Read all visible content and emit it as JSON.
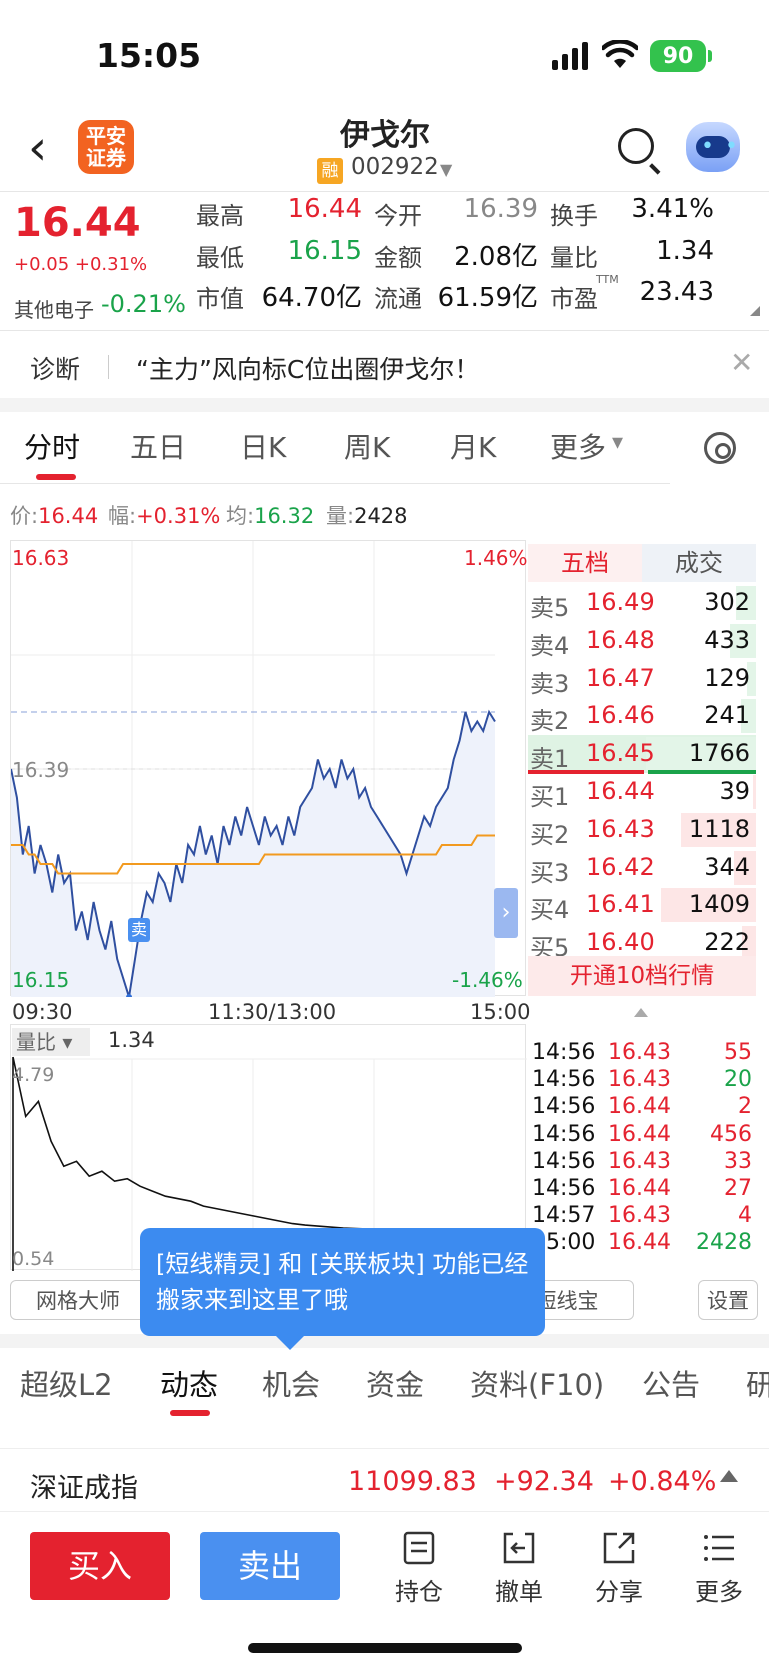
{
  "status": {
    "time": "15:05",
    "battery": "90"
  },
  "header": {
    "title": "伊戈尔",
    "logo": "平安\n证券",
    "rong": "融",
    "code": "002922"
  },
  "quote": {
    "price": "16.44",
    "change": "+0.05 +0.31%",
    "sector": "其他电子",
    "sector_change": "-0.21%",
    "rows": [
      [
        {
          "l": "最高",
          "v": "16.44",
          "c": "red"
        },
        {
          "l": "今开",
          "v": "16.39",
          "c": "gray"
        },
        {
          "l": "换手",
          "v": "3.41%",
          "c": "dark"
        }
      ],
      [
        {
          "l": "最低",
          "v": "16.15",
          "c": "green"
        },
        {
          "l": "金额",
          "v": "2.08亿",
          "c": "dark"
        },
        {
          "l": "量比",
          "v": "1.34",
          "c": "dark"
        }
      ],
      [
        {
          "l": "市值",
          "v": "64.70亿",
          "c": "dark"
        },
        {
          "l": "流通",
          "v": "61.59亿",
          "c": "dark"
        },
        {
          "l": "市盈",
          "v": "23.43",
          "c": "dark",
          "sup": "TTM"
        }
      ]
    ]
  },
  "diag": {
    "label": "诊断",
    "text": "“主力”风向标C位出圈伊戈尔！"
  },
  "chart_tabs": [
    "分时",
    "五日",
    "日K",
    "周K",
    "月K",
    "更多"
  ],
  "info": {
    "price_l": "价:",
    "price": "16.44",
    "amp_l": "幅:",
    "amp": "+0.31%",
    "avg_l": "均:",
    "avg": "16.32",
    "vol_l": "量:",
    "vol": "2428"
  },
  "chart_data": {
    "type": "line",
    "y_ticks": {
      "top": "16.63",
      "mid": "16.39",
      "bottom": "16.15",
      "top_pct": "1.46%",
      "bottom_pct": "-1.46%"
    },
    "x_ticks": [
      "09:30",
      "11:30/13:00",
      "15:00"
    ],
    "ylim": [
      16.15,
      16.63
    ],
    "prev_close": 16.39,
    "series": [
      {
        "values": [
          16.39,
          16.36,
          16.3,
          16.33,
          16.28,
          16.31,
          16.29,
          16.26,
          16.3,
          16.27,
          16.28,
          16.22,
          16.24,
          16.21,
          16.25,
          16.22,
          16.2,
          16.23,
          16.19,
          16.17,
          16.15,
          16.19,
          16.23,
          16.26,
          16.25,
          16.28,
          16.27,
          16.25,
          16.29,
          16.27,
          16.31,
          16.3,
          16.33,
          16.3,
          16.32,
          16.29,
          16.33,
          16.31,
          16.34,
          16.32,
          16.35,
          16.33,
          16.31,
          16.34,
          16.32,
          16.33,
          16.31,
          16.34,
          16.32,
          16.35,
          16.36,
          16.37,
          16.4,
          16.38,
          16.39,
          16.37,
          16.4,
          16.38,
          16.39,
          16.36,
          16.37,
          16.35,
          16.34,
          16.33,
          16.32,
          16.31,
          16.3,
          16.28,
          16.3,
          16.32,
          16.34,
          16.33,
          16.35,
          16.36,
          16.37,
          16.4,
          16.42,
          16.45,
          16.43,
          16.44,
          16.43,
          16.45,
          16.44
        ]
      },
      {
        "values": [
          16.31,
          16.31,
          16.31,
          16.3,
          16.3,
          16.29,
          16.29,
          16.29,
          16.28,
          16.28,
          16.28,
          16.28,
          16.28,
          16.28,
          16.28,
          16.28,
          16.28,
          16.28,
          16.28,
          16.29,
          16.29,
          16.29,
          16.29,
          16.29,
          16.29,
          16.29,
          16.29,
          16.29,
          16.29,
          16.29,
          16.29,
          16.29,
          16.29,
          16.29,
          16.29,
          16.29,
          16.29,
          16.29,
          16.29,
          16.29,
          16.29,
          16.29,
          16.29,
          16.3,
          16.3,
          16.3,
          16.3,
          16.3,
          16.3,
          16.3,
          16.3,
          16.3,
          16.3,
          16.3,
          16.3,
          16.3,
          16.3,
          16.3,
          16.3,
          16.3,
          16.3,
          16.3,
          16.3,
          16.3,
          16.3,
          16.3,
          16.3,
          16.3,
          16.3,
          16.3,
          16.3,
          16.3,
          16.3,
          16.31,
          16.31,
          16.31,
          16.31,
          16.31,
          16.31,
          16.32,
          16.32,
          16.32,
          16.32
        ]
      }
    ],
    "sell_marker": "卖"
  },
  "orderbook": {
    "tabs": [
      "五档",
      "成交"
    ],
    "asks": [
      {
        "l": "卖5",
        "p": "16.49",
        "v": "302",
        "w": 0.18
      },
      {
        "l": "卖4",
        "p": "16.48",
        "v": "433",
        "w": 0.24
      },
      {
        "l": "卖3",
        "p": "16.47",
        "v": "129",
        "w": 0.08
      },
      {
        "l": "卖2",
        "p": "16.46",
        "v": "241",
        "w": 0.14
      },
      {
        "l": "卖1",
        "p": "16.45",
        "v": "1766",
        "w": 1.0
      }
    ],
    "bids": [
      {
        "l": "买1",
        "p": "16.44",
        "v": "39",
        "w": 0.03
      },
      {
        "l": "买2",
        "p": "16.43",
        "v": "1118",
        "w": 0.68
      },
      {
        "l": "买3",
        "p": "16.42",
        "v": "344",
        "w": 0.2
      },
      {
        "l": "买4",
        "p": "16.41",
        "v": "1409",
        "w": 0.86
      },
      {
        "l": "买5",
        "p": "16.40",
        "v": "222",
        "w": 0.13
      }
    ],
    "open10": "开通10档行情"
  },
  "ticks": [
    {
      "t": "14:56",
      "p": "16.43",
      "v": "55",
      "c": "red"
    },
    {
      "t": "14:56",
      "p": "16.43",
      "v": "20",
      "c": "green"
    },
    {
      "t": "14:56",
      "p": "16.44",
      "v": "2",
      "c": "red"
    },
    {
      "t": "14:56",
      "p": "16.44",
      "v": "456",
      "c": "red"
    },
    {
      "t": "14:56",
      "p": "16.43",
      "v": "33",
      "c": "red"
    },
    {
      "t": "14:56",
      "p": "16.44",
      "v": "27",
      "c": "red"
    },
    {
      "t": "14:57",
      "p": "16.43",
      "v": "4",
      "c": "red"
    },
    {
      "t": "15:00",
      "p": "16.44",
      "v": "2428",
      "c": "green"
    }
  ],
  "vol_ratio": {
    "selector": "量比",
    "value": "1.34",
    "top": "4.79",
    "bottom": "0.54",
    "values": [
      4.79,
      3.6,
      3.9,
      3.1,
      2.6,
      2.7,
      2.4,
      2.5,
      2.3,
      2.35,
      2.2,
      2.1,
      2.0,
      1.95,
      1.9,
      1.8,
      1.75,
      1.7,
      1.65,
      1.6,
      1.55,
      1.5,
      1.45,
      1.42,
      1.4,
      1.38,
      1.36,
      1.35,
      1.34,
      1.34,
      1.33,
      1.33,
      1.32,
      1.32,
      1.31,
      1.31,
      1.3,
      1.3
    ]
  },
  "pills": [
    "网格大师",
    "短线宝",
    "设置"
  ],
  "tooltip": "[短线精灵] 和 [关联板块] 功能已经搬家来到这里了哦",
  "bottom_tabs": [
    "超级L2",
    "动态",
    "机会",
    "资金",
    "资料(F10)",
    "公告",
    "研"
  ],
  "index": {
    "name": "深证成指",
    "value": "11099.83",
    "change": "+92.34",
    "pct": "+0.84%"
  },
  "trade": {
    "buy": "买入",
    "sell": "卖出",
    "actions": [
      "持仓",
      "撤单",
      "分享",
      "更多"
    ]
  }
}
